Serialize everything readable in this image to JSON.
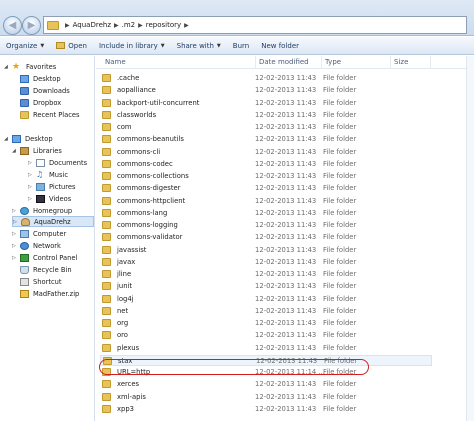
{
  "address": {
    "crumbs": [
      "AquaDrehz",
      ".m2",
      "repository"
    ]
  },
  "toolbar": {
    "organize": "Organize",
    "open": "Open",
    "include": "Include in library",
    "share": "Share with",
    "burn": "Burn",
    "new_folder": "New folder"
  },
  "nav": {
    "favorites": "Favorites",
    "desktop": "Desktop",
    "downloads": "Downloads",
    "dropbox": "Dropbox",
    "recent": "Recent Places",
    "desktop2": "Desktop",
    "libraries": "Libraries",
    "documents": "Documents",
    "music": "Music",
    "pictures": "Pictures",
    "videos": "Videos",
    "homegroup": "Homegroup",
    "user": "AquaDrehz",
    "computer": "Computer",
    "network": "Network",
    "control_panel": "Control Panel",
    "recycle": "Recycle Bin",
    "shortcut": "Shortcut",
    "zip": "MadFather.zip"
  },
  "columns": {
    "name": "Name",
    "date": "Date modified",
    "type": "Type",
    "size": "Size"
  },
  "files": [
    {
      "name": ".cache",
      "date": "12-02-2013 11:43",
      "type": "File folder"
    },
    {
      "name": "aopalliance",
      "date": "12-02-2013 11:43",
      "type": "File folder"
    },
    {
      "name": "backport-util-concurrent",
      "date": "12-02-2013 11:43",
      "type": "File folder"
    },
    {
      "name": "classworlds",
      "date": "12-02-2013 11:43",
      "type": "File folder"
    },
    {
      "name": "com",
      "date": "12-02-2013 11:43",
      "type": "File folder"
    },
    {
      "name": "commons-beanutils",
      "date": "12-02-2013 11:43",
      "type": "File folder"
    },
    {
      "name": "commons-cli",
      "date": "12-02-2013 11:43",
      "type": "File folder"
    },
    {
      "name": "commons-codec",
      "date": "12-02-2013 11:43",
      "type": "File folder"
    },
    {
      "name": "commons-collections",
      "date": "12-02-2013 11:43",
      "type": "File folder"
    },
    {
      "name": "commons-digester",
      "date": "12-02-2013 11:43",
      "type": "File folder"
    },
    {
      "name": "commons-httpclient",
      "date": "12-02-2013 11:43",
      "type": "File folder"
    },
    {
      "name": "commons-lang",
      "date": "12-02-2013 11:43",
      "type": "File folder"
    },
    {
      "name": "commons-logging",
      "date": "12-02-2013 11:43",
      "type": "File folder"
    },
    {
      "name": "commons-validator",
      "date": "12-02-2013 11:43",
      "type": "File folder"
    },
    {
      "name": "javassist",
      "date": "12-02-2013 11:43",
      "type": "File folder"
    },
    {
      "name": "javax",
      "date": "12-02-2013 11:43",
      "type": "File folder"
    },
    {
      "name": "jline",
      "date": "12-02-2013 11:43",
      "type": "File folder"
    },
    {
      "name": "junit",
      "date": "12-02-2013 11:43",
      "type": "File folder"
    },
    {
      "name": "log4j",
      "date": "12-02-2013 11:43",
      "type": "File folder"
    },
    {
      "name": "net",
      "date": "12-02-2013 11:43",
      "type": "File folder"
    },
    {
      "name": "org",
      "date": "12-02-2013 11:43",
      "type": "File folder"
    },
    {
      "name": "oro",
      "date": "12-02-2013 11:43",
      "type": "File folder"
    },
    {
      "name": "plexus",
      "date": "12-02-2013 11:43",
      "type": "File folder"
    },
    {
      "name": "stax",
      "date": "12-02-2013 11:43",
      "type": "File folder"
    },
    {
      "name": "URL=http",
      "date": "12-02-2013 11:14 ...",
      "type": "File folder"
    },
    {
      "name": "xerces",
      "date": "12-02-2013 11:43",
      "type": "File folder"
    },
    {
      "name": "xml-apis",
      "date": "12-02-2013 11:43",
      "type": "File folder"
    },
    {
      "name": "xpp3",
      "date": "12-02-2013 11:43",
      "type": "File folder"
    }
  ],
  "colors": {
    "highlight_ring": "#d61d1d",
    "folder": "#e8c35c",
    "selection": "#d8e6f6"
  }
}
